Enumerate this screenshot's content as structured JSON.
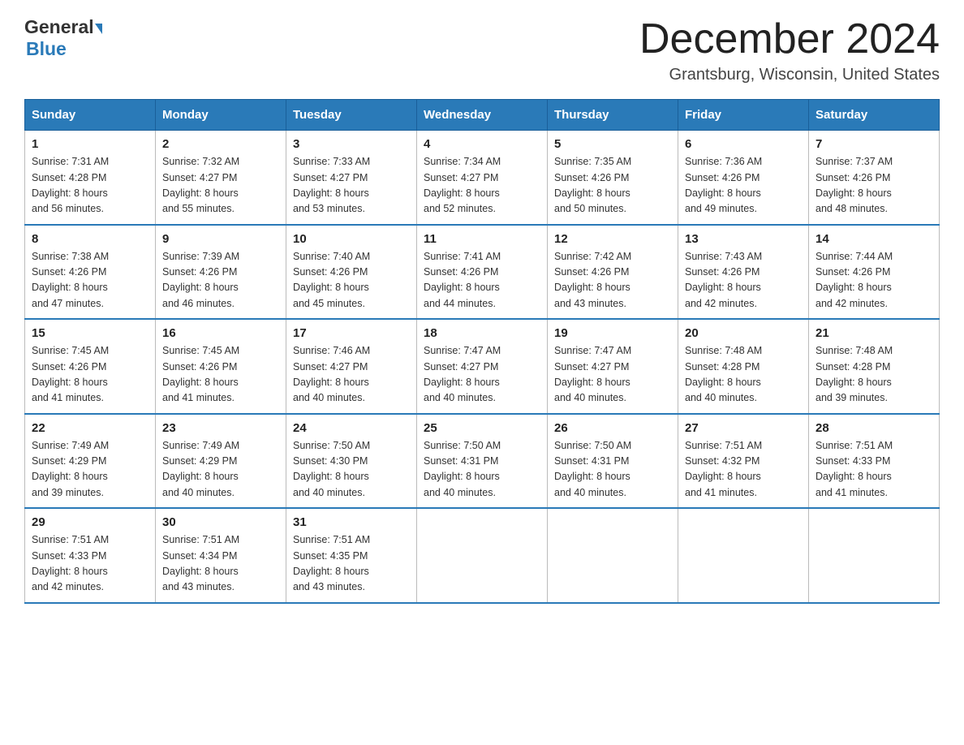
{
  "header": {
    "logo": {
      "general": "General",
      "arrow_color": "#2a7ab8",
      "blue": "Blue"
    },
    "title": "December 2024",
    "location": "Grantsburg, Wisconsin, United States"
  },
  "weekdays": [
    "Sunday",
    "Monday",
    "Tuesday",
    "Wednesday",
    "Thursday",
    "Friday",
    "Saturday"
  ],
  "weeks": [
    [
      {
        "day": "1",
        "sunrise": "7:31 AM",
        "sunset": "4:28 PM",
        "daylight": "8 hours and 56 minutes."
      },
      {
        "day": "2",
        "sunrise": "7:32 AM",
        "sunset": "4:27 PM",
        "daylight": "8 hours and 55 minutes."
      },
      {
        "day": "3",
        "sunrise": "7:33 AM",
        "sunset": "4:27 PM",
        "daylight": "8 hours and 53 minutes."
      },
      {
        "day": "4",
        "sunrise": "7:34 AM",
        "sunset": "4:27 PM",
        "daylight": "8 hours and 52 minutes."
      },
      {
        "day": "5",
        "sunrise": "7:35 AM",
        "sunset": "4:26 PM",
        "daylight": "8 hours and 50 minutes."
      },
      {
        "day": "6",
        "sunrise": "7:36 AM",
        "sunset": "4:26 PM",
        "daylight": "8 hours and 49 minutes."
      },
      {
        "day": "7",
        "sunrise": "7:37 AM",
        "sunset": "4:26 PM",
        "daylight": "8 hours and 48 minutes."
      }
    ],
    [
      {
        "day": "8",
        "sunrise": "7:38 AM",
        "sunset": "4:26 PM",
        "daylight": "8 hours and 47 minutes."
      },
      {
        "day": "9",
        "sunrise": "7:39 AM",
        "sunset": "4:26 PM",
        "daylight": "8 hours and 46 minutes."
      },
      {
        "day": "10",
        "sunrise": "7:40 AM",
        "sunset": "4:26 PM",
        "daylight": "8 hours and 45 minutes."
      },
      {
        "day": "11",
        "sunrise": "7:41 AM",
        "sunset": "4:26 PM",
        "daylight": "8 hours and 44 minutes."
      },
      {
        "day": "12",
        "sunrise": "7:42 AM",
        "sunset": "4:26 PM",
        "daylight": "8 hours and 43 minutes."
      },
      {
        "day": "13",
        "sunrise": "7:43 AM",
        "sunset": "4:26 PM",
        "daylight": "8 hours and 42 minutes."
      },
      {
        "day": "14",
        "sunrise": "7:44 AM",
        "sunset": "4:26 PM",
        "daylight": "8 hours and 42 minutes."
      }
    ],
    [
      {
        "day": "15",
        "sunrise": "7:45 AM",
        "sunset": "4:26 PM",
        "daylight": "8 hours and 41 minutes."
      },
      {
        "day": "16",
        "sunrise": "7:45 AM",
        "sunset": "4:26 PM",
        "daylight": "8 hours and 41 minutes."
      },
      {
        "day": "17",
        "sunrise": "7:46 AM",
        "sunset": "4:27 PM",
        "daylight": "8 hours and 40 minutes."
      },
      {
        "day": "18",
        "sunrise": "7:47 AM",
        "sunset": "4:27 PM",
        "daylight": "8 hours and 40 minutes."
      },
      {
        "day": "19",
        "sunrise": "7:47 AM",
        "sunset": "4:27 PM",
        "daylight": "8 hours and 40 minutes."
      },
      {
        "day": "20",
        "sunrise": "7:48 AM",
        "sunset": "4:28 PM",
        "daylight": "8 hours and 40 minutes."
      },
      {
        "day": "21",
        "sunrise": "7:48 AM",
        "sunset": "4:28 PM",
        "daylight": "8 hours and 39 minutes."
      }
    ],
    [
      {
        "day": "22",
        "sunrise": "7:49 AM",
        "sunset": "4:29 PM",
        "daylight": "8 hours and 39 minutes."
      },
      {
        "day": "23",
        "sunrise": "7:49 AM",
        "sunset": "4:29 PM",
        "daylight": "8 hours and 40 minutes."
      },
      {
        "day": "24",
        "sunrise": "7:50 AM",
        "sunset": "4:30 PM",
        "daylight": "8 hours and 40 minutes."
      },
      {
        "day": "25",
        "sunrise": "7:50 AM",
        "sunset": "4:31 PM",
        "daylight": "8 hours and 40 minutes."
      },
      {
        "day": "26",
        "sunrise": "7:50 AM",
        "sunset": "4:31 PM",
        "daylight": "8 hours and 40 minutes."
      },
      {
        "day": "27",
        "sunrise": "7:51 AM",
        "sunset": "4:32 PM",
        "daylight": "8 hours and 41 minutes."
      },
      {
        "day": "28",
        "sunrise": "7:51 AM",
        "sunset": "4:33 PM",
        "daylight": "8 hours and 41 minutes."
      }
    ],
    [
      {
        "day": "29",
        "sunrise": "7:51 AM",
        "sunset": "4:33 PM",
        "daylight": "8 hours and 42 minutes."
      },
      {
        "day": "30",
        "sunrise": "7:51 AM",
        "sunset": "4:34 PM",
        "daylight": "8 hours and 43 minutes."
      },
      {
        "day": "31",
        "sunrise": "7:51 AM",
        "sunset": "4:35 PM",
        "daylight": "8 hours and 43 minutes."
      },
      null,
      null,
      null,
      null
    ]
  ],
  "labels": {
    "sunrise": "Sunrise:",
    "sunset": "Sunset:",
    "daylight": "Daylight:"
  }
}
